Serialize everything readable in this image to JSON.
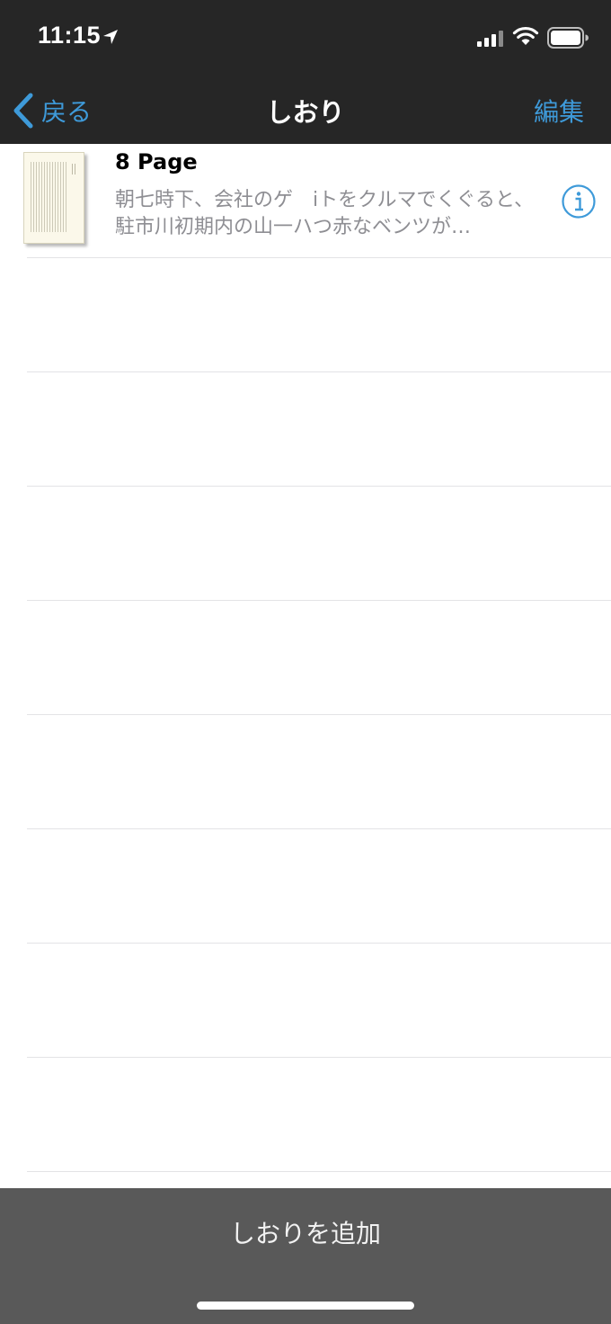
{
  "status_bar": {
    "time": "11:15",
    "icons": [
      "location-arrow-icon",
      "signal-icon",
      "wifi-icon",
      "battery-icon"
    ]
  },
  "nav": {
    "back_label": "戻る",
    "title": "しおり",
    "edit_label": "編集"
  },
  "bookmarks": [
    {
      "title": "8 Page",
      "snippet": "朝七時下、会社のゲ　iトをクルマでくぐると、駐市川初期内の山一ハつ赤なベンツが…",
      "icon": "info-icon"
    }
  ],
  "bottom_bar": {
    "add_label": "しおりを追加"
  },
  "colors": {
    "bar_bg": "#262626",
    "accent": "#3e9ad9",
    "toolbar_bg": "#595959",
    "snippet_text": "#8e8e93"
  }
}
